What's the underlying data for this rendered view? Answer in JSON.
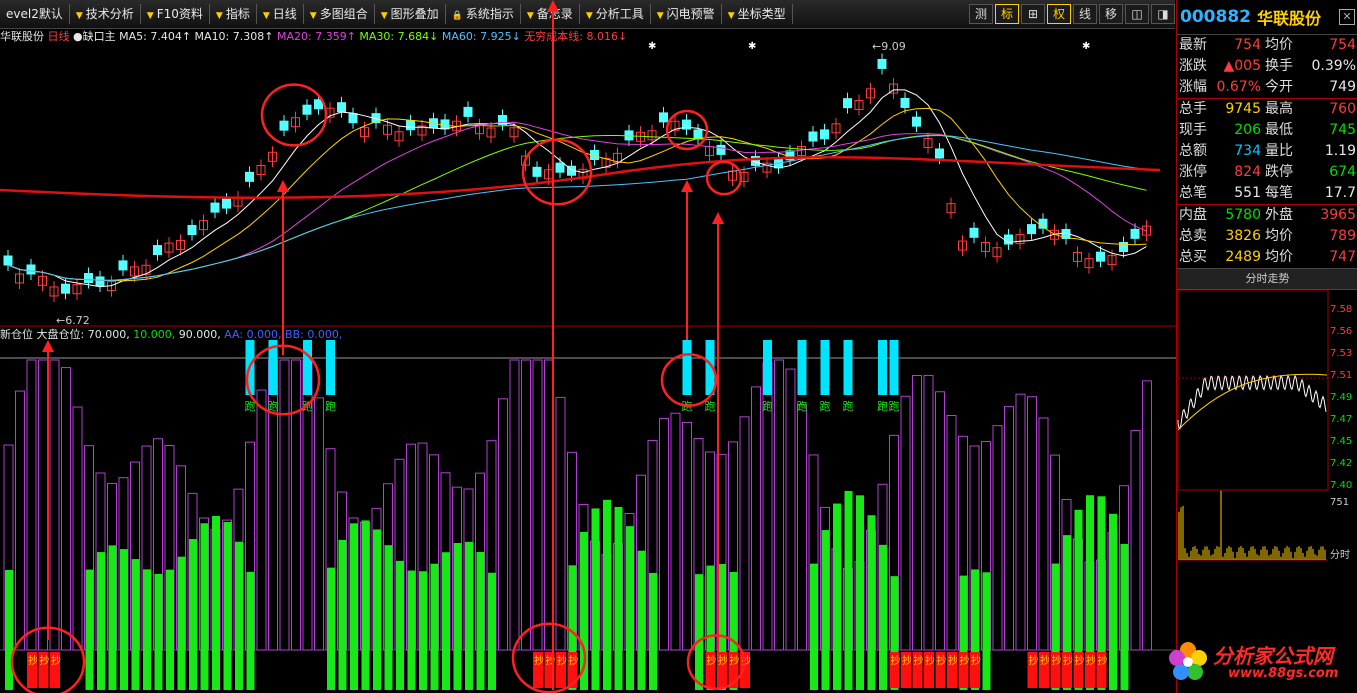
{
  "toolbar": {
    "items": [
      "evel2默认",
      "技术分析",
      "F10资料",
      "指标",
      "日线",
      "多图组合",
      "图形叠加",
      "系统指示",
      "备忘录",
      "分析工具",
      "闪电预警",
      "坐标类型"
    ],
    "right_buttons": [
      "测",
      "标",
      "⊞",
      "权",
      "线",
      "移",
      "◫",
      "◨"
    ]
  },
  "ma_header": {
    "stock": "华联股份",
    "period": "日线",
    "flag": "缺口主",
    "ma5": "MA5: 7.404↑",
    "ma10": "MA10: 7.308↑",
    "ma20": "MA20: 7.359↑",
    "ma30": "MA30: 7.684↓",
    "ma60": "MA60: 7.925↓",
    "cost": "无穷成本线: 8.016↓"
  },
  "indicator_header": {
    "name": "新仓位",
    "values": "大盘仓位: 70.000,",
    "v2": "10.000,",
    "v3": "90.000,",
    "v4": "AA: 0.000, BB: 0.000,"
  },
  "labels": {
    "high_price": "9.09",
    "low_price": "6.72",
    "run": "跑",
    "buy": "抄"
  },
  "quote": {
    "code": "000882",
    "name": "华联股份",
    "rows": [
      {
        "l1": "最新",
        "v1": "754",
        "c1": "red",
        "l2": "均价",
        "v2": "754",
        "c2": "red"
      },
      {
        "l1": "涨跌",
        "v1": "▲005",
        "c1": "red",
        "l2": "换手",
        "v2": "0.39%",
        "c2": "white"
      },
      {
        "l1": "涨幅",
        "v1": "0.67%",
        "c1": "red",
        "l2": "今开",
        "v2": "749",
        "c2": "white"
      },
      {
        "l1": "总手",
        "v1": "9745",
        "c1": "yellow",
        "l2": "最高",
        "v2": "760",
        "c2": "red"
      },
      {
        "l1": "现手",
        "v1": "206",
        "c1": "green",
        "l2": "最低",
        "v2": "745",
        "c2": "green"
      },
      {
        "l1": "总额",
        "v1": "734",
        "c1": "cyan",
        "l2": "量比",
        "v2": "1.19",
        "c2": "white"
      },
      {
        "l1": "涨停",
        "v1": "824",
        "c1": "red",
        "l2": "跌停",
        "v2": "674",
        "c2": "green"
      },
      {
        "l1": "总笔",
        "v1": "551",
        "c1": "white",
        "l2": "每笔",
        "v2": "17.7",
        "c2": "white"
      },
      {
        "l1": "内盘",
        "v1": "5780",
        "c1": "green",
        "l2": "外盘",
        "v2": "3965",
        "c2": "red"
      },
      {
        "l1": "总卖",
        "v1": "3826",
        "c1": "yellow",
        "l2": "均价",
        "v2": "789",
        "c2": "red"
      },
      {
        "l1": "总买",
        "v1": "2489",
        "c1": "yellow",
        "l2": "均价",
        "v2": "747",
        "c2": "red"
      }
    ],
    "intraday_title": "分时走势",
    "axis_prices": [
      "7.58",
      "7.56",
      "7.53",
      "7.51",
      "7.49",
      "7.47",
      "7.45",
      "7.42",
      "7.40"
    ],
    "vol_label": "751",
    "time_label": "分时"
  },
  "watermark": {
    "text": "分析家公式网",
    "url": "www.88gs.com"
  }
}
